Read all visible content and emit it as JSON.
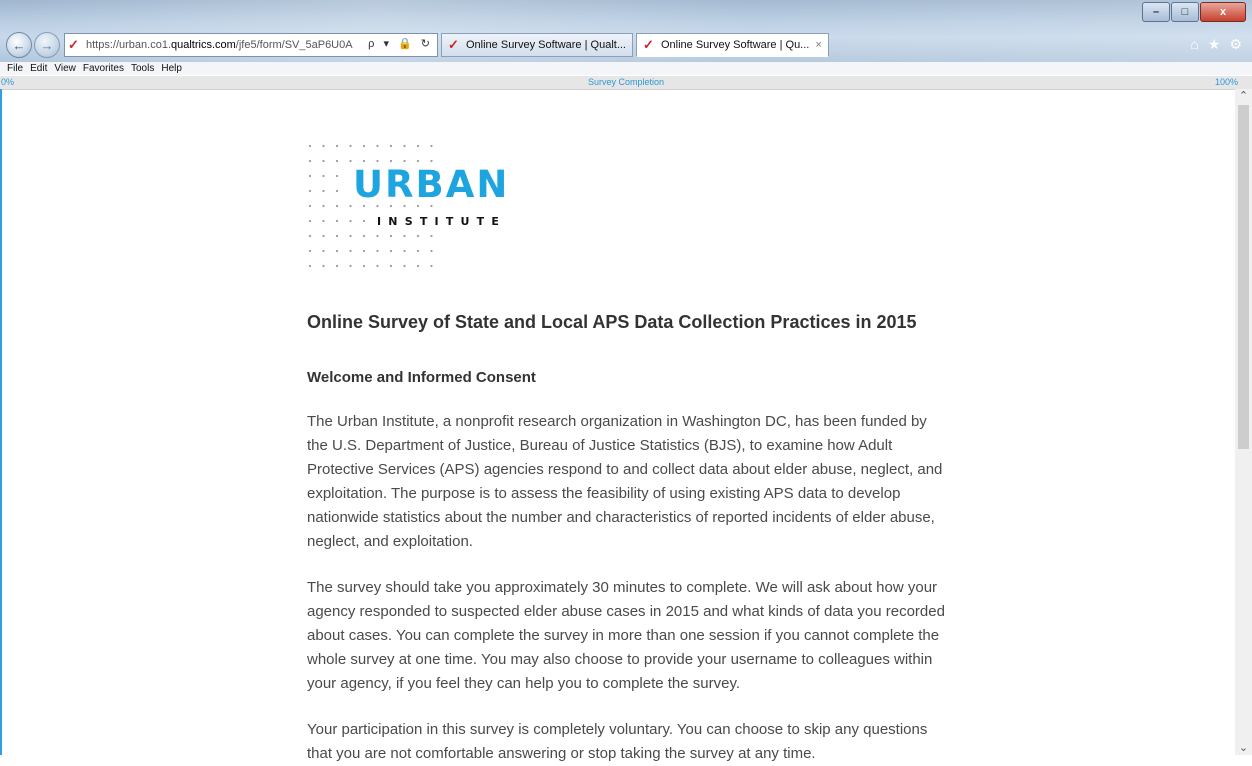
{
  "browser": {
    "url_prefix": "https://urban.co1.",
    "url_domain": "qualtrics.com",
    "url_path": "/jfe5/form/SV_5aP6U0A",
    "address_tools": "ρ ▾ 🔒 ↻",
    "tabs": [
      {
        "label": "Online Survey Software | Qualt..."
      },
      {
        "label": "Online Survey Software | Qu...",
        "close": "×"
      }
    ],
    "window_controls": {
      "minimize": "–",
      "maximize": "□",
      "close": "x"
    }
  },
  "menu": {
    "items": [
      "File",
      "Edit",
      "View",
      "Favorites",
      "Tools",
      "Help"
    ]
  },
  "progress": {
    "start_label": "0%",
    "center_label": "Survey Completion",
    "end_label": "100%",
    "value_percent": 0
  },
  "logo": {
    "word1": "URBAN",
    "word2": "INSTITUTE",
    "brand_color": "#1ea5e0"
  },
  "survey": {
    "title": "Online Survey of State and Local APS Data Collection Practices in 2015",
    "section_heading": "Welcome and Informed Consent",
    "paragraphs": [
      "The Urban Institute, a nonprofit research organization in Washington DC, has been funded by the U.S. Department of Justice, Bureau of Justice Statistics (BJS), to examine how Adult Protective Services (APS) agencies respond to and collect data about elder abuse, neglect, and exploitation.  The purpose is to assess the feasibility of using existing APS data to develop nationwide statistics about the number and characteristics of reported incidents of elder abuse, neglect, and exploitation.",
      "The survey should take you approximately 30 minutes to complete.  We will ask about how your agency responded to suspected elder abuse cases in 2015 and what kinds of data you recorded about cases.  You can complete the survey in more than one session if you cannot complete the whole survey at one time.  You may also choose to provide your username to colleagues within your agency, if you feel they can help you to complete the survey.",
      "Your participation in this survey is completely voluntary. You can choose to skip any questions that you are not comfortable answering or stop taking the survey at any time."
    ]
  },
  "colors": {
    "accent": "#2ea0e3",
    "progress_text": "#2e97d6"
  }
}
